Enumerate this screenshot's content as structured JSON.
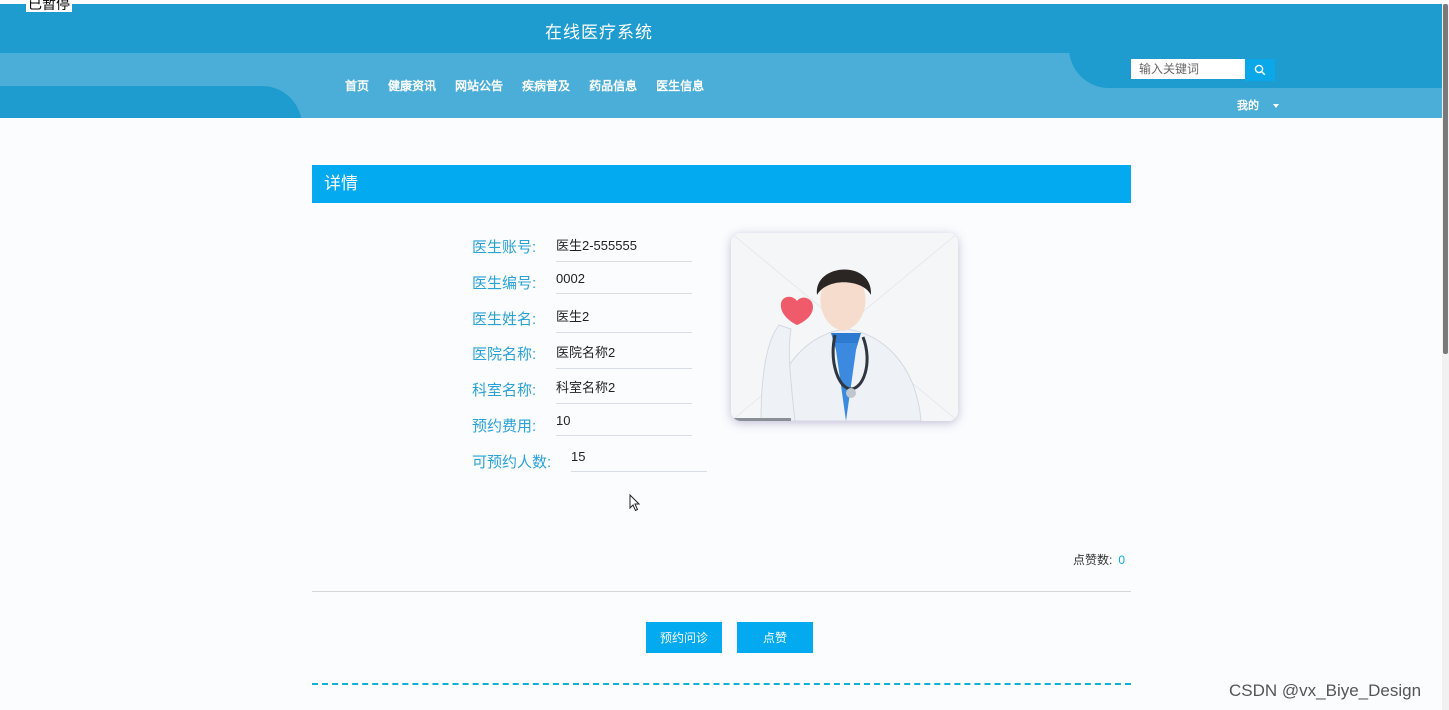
{
  "overlay": {
    "paused_label": "已暂停"
  },
  "header": {
    "site_title": "在线医疗系统",
    "nav": [
      "首页",
      "健康资讯",
      "网站公告",
      "疾病普及",
      "药品信息",
      "医生信息"
    ],
    "search": {
      "placeholder": "输入关键词",
      "icon": "search-icon"
    },
    "user_menu_label": "我的"
  },
  "detail": {
    "heading": "详情",
    "fields": [
      {
        "label": "医生账号:",
        "value": "医生2-555555"
      },
      {
        "label": "医生编号:",
        "value": "0002"
      },
      {
        "label": "医生姓名:",
        "value": "医生2"
      },
      {
        "label": "医院名称:",
        "value": "医院名称2"
      },
      {
        "label": "科室名称:",
        "value": "科室名称2"
      },
      {
        "label": "预约费用:",
        "value": "10"
      },
      {
        "label": "可预约人数:",
        "value": "15"
      }
    ],
    "likes_label": "点赞数:",
    "likes_count": "0",
    "buttons": {
      "book": "预约问诊",
      "like": "点赞"
    }
  },
  "watermark": "CSDN @vx_Biye_Design",
  "colors": {
    "header": "#1e9ccf",
    "header_light": "#4aaed8",
    "accent": "#04aaf0",
    "label": "#2aa2d6"
  }
}
